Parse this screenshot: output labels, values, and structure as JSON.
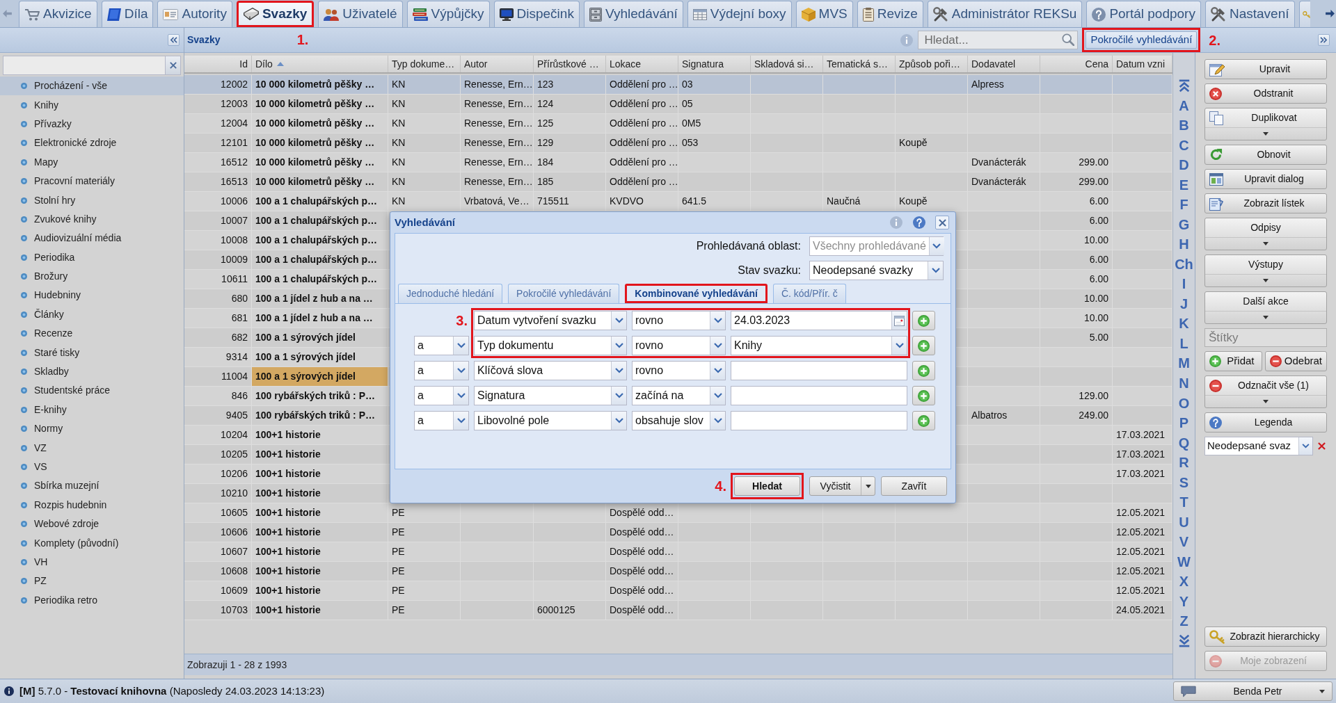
{
  "tabs": [
    {
      "label": "Akvizice",
      "selected": false,
      "outlined": false
    },
    {
      "label": "Díla",
      "selected": false,
      "outlined": false
    },
    {
      "label": "Autority",
      "selected": false,
      "outlined": false
    },
    {
      "label": "Svazky",
      "selected": true,
      "outlined": true,
      "callout": "1."
    },
    {
      "label": "Uživatelé",
      "selected": false,
      "outlined": false
    },
    {
      "label": "Výpůjčky",
      "selected": false,
      "outlined": false
    },
    {
      "label": "Dispečink",
      "selected": false,
      "outlined": false
    },
    {
      "label": "Vyhledávání",
      "selected": false,
      "outlined": false
    },
    {
      "label": "Výdejní boxy",
      "selected": false,
      "outlined": false
    },
    {
      "label": "MVS",
      "selected": false,
      "outlined": false
    },
    {
      "label": "Revize",
      "selected": false,
      "outlined": false
    },
    {
      "label": "Administrátor REKSu",
      "selected": false,
      "outlined": false
    },
    {
      "label": "Portál podpory",
      "selected": false,
      "outlined": false
    },
    {
      "label": "Nastavení",
      "selected": false,
      "outlined": false
    }
  ],
  "sidebar": {
    "items": [
      {
        "label": "Procházení - vše",
        "selected": true
      },
      {
        "label": "Knihy",
        "selected": false
      },
      {
        "label": "Přívazky",
        "selected": false
      },
      {
        "label": "Elektronické zdroje",
        "selected": false
      },
      {
        "label": "Mapy",
        "selected": false
      },
      {
        "label": "Pracovní materiály",
        "selected": false
      },
      {
        "label": "Stolní hry",
        "selected": false
      },
      {
        "label": "Zvukové knihy",
        "selected": false
      },
      {
        "label": "Audiovizuální média",
        "selected": false
      },
      {
        "label": "Periodika",
        "selected": false
      },
      {
        "label": "Brožury",
        "selected": false
      },
      {
        "label": "Hudebniny",
        "selected": false
      },
      {
        "label": "Články",
        "selected": false
      },
      {
        "label": "Recenze",
        "selected": false
      },
      {
        "label": "Staré tisky",
        "selected": false
      },
      {
        "label": "Skladby",
        "selected": false
      },
      {
        "label": "Studentské práce",
        "selected": false
      },
      {
        "label": "E-knihy",
        "selected": false
      },
      {
        "label": "Normy",
        "selected": false
      },
      {
        "label": "VZ",
        "selected": false
      },
      {
        "label": "VS",
        "selected": false
      },
      {
        "label": "Sbírka muzejní",
        "selected": false
      },
      {
        "label": "Rozpis hudebnin",
        "selected": false
      },
      {
        "label": "Webové zdroje",
        "selected": false
      },
      {
        "label": "Komplety (původní)",
        "selected": false
      },
      {
        "label": "VH",
        "selected": false
      },
      {
        "label": "PZ",
        "selected": false
      },
      {
        "label": "Periodika retro",
        "selected": false
      }
    ]
  },
  "panel": {
    "title": "Svazky",
    "search": {
      "placeholder": "Hledat..."
    },
    "advanced_search": {
      "label": "Pokročilé vyhledávání",
      "outlined": true,
      "callout": "2."
    }
  },
  "table": {
    "columns": [
      {
        "label": "Id",
        "sorted": false
      },
      {
        "label": "Dílo",
        "sorted": true
      },
      {
        "label": "Typ dokume…",
        "sorted": false
      },
      {
        "label": "Autor",
        "sorted": false
      },
      {
        "label": "Přírůstkové …",
        "sorted": false
      },
      {
        "label": "Lokace",
        "sorted": false
      },
      {
        "label": "Signatura",
        "sorted": false
      },
      {
        "label": "Skladová si…",
        "sorted": false
      },
      {
        "label": "Tematická s…",
        "sorted": false
      },
      {
        "label": "Způsob poři…",
        "sorted": false
      },
      {
        "label": "Dodavatel",
        "sorted": false
      },
      {
        "label": "Cena",
        "sorted": false
      },
      {
        "label": "Datum vzni",
        "sorted": false
      }
    ],
    "rows": [
      {
        "id": "12002",
        "dilo": "10 000 kilometrů pěšky …",
        "typ_dokume": "KN",
        "autor": "Renesse, Ern…",
        "prirustkove": "123",
        "lokace": "Oddělení pro …",
        "signatura": "03",
        "dodavatel": "Alpress",
        "selected": true,
        "highlighted": false
      },
      {
        "id": "12003",
        "dilo": "10 000 kilometrů pěšky …",
        "typ_dokume": "KN",
        "autor": "Renesse, Ern…",
        "prirustkove": "124",
        "lokace": "Oddělení pro …",
        "signatura": "05",
        "selected": false,
        "highlighted": false
      },
      {
        "id": "12004",
        "dilo": "10 000 kilometrů pěšky …",
        "typ_dokume": "KN",
        "autor": "Renesse, Ern…",
        "prirustkove": "125",
        "lokace": "Oddělení pro …",
        "signatura": "0M5",
        "selected": false,
        "highlighted": false
      },
      {
        "id": "12101",
        "dilo": "10 000 kilometrů pěšky …",
        "typ_dokume": "KN",
        "autor": "Renesse, Ern…",
        "prirustkove": "129",
        "lokace": "Oddělení pro …",
        "signatura": "053",
        "zpusob_pori": "Koupě",
        "selected": false,
        "highlighted": false
      },
      {
        "id": "16512",
        "dilo": "10 000 kilometrů pěšky …",
        "typ_dokume": "KN",
        "autor": "Renesse, Ern…",
        "prirustkove": "184",
        "lokace": "Oddělení pro …",
        "dodavatel": "Dvanácterák",
        "cena": "299.00",
        "selected": false,
        "highlighted": false
      },
      {
        "id": "16513",
        "dilo": "10 000 kilometrů pěšky …",
        "typ_dokume": "KN",
        "autor": "Renesse, Ern…",
        "prirustkove": "185",
        "lokace": "Oddělení pro …",
        "dodavatel": "Dvanácterák",
        "cena": "299.00",
        "selected": false,
        "highlighted": false
      },
      {
        "id": "10006",
        "dilo": "100 a 1 chalupářských p…",
        "typ_dokume": "KN",
        "autor": "Vrbatová, Ve…",
        "prirustkove": "715511",
        "lokace": "KVDVO",
        "signatura": "641.5",
        "tematicka_s": "Naučná",
        "zpusob_pori": "Koupě",
        "cena": "6.00",
        "selected": false,
        "highlighted": false
      },
      {
        "id": "10007",
        "dilo": "100 a 1 chalupářských p…",
        "cena": "6.00",
        "selected": false,
        "highlighted": false
      },
      {
        "id": "10008",
        "dilo": "100 a 1 chalupářských p…",
        "cena": "10.00",
        "selected": false,
        "highlighted": false
      },
      {
        "id": "10009",
        "dilo": "100 a 1 chalupářských p…",
        "cena": "6.00",
        "selected": false,
        "highlighted": false
      },
      {
        "id": "10611",
        "dilo": "100 a 1 chalupářských p…",
        "cena": "6.00",
        "selected": false,
        "highlighted": false
      },
      {
        "id": "680",
        "dilo": "100 a 1 jídel z hub a na …",
        "cena": "10.00",
        "selected": false,
        "highlighted": false
      },
      {
        "id": "681",
        "dilo": "100 a 1 jídel z hub a na …",
        "cena": "10.00",
        "selected": false,
        "highlighted": false
      },
      {
        "id": "682",
        "dilo": "100 a 1 sýrových jídel",
        "cena": "5.00",
        "selected": false,
        "highlighted": false
      },
      {
        "id": "9314",
        "dilo": "100 a 1 sýrových jídel",
        "selected": false,
        "highlighted": false
      },
      {
        "id": "11004",
        "dilo": "100 a 1 sýrových jídel",
        "selected": false,
        "highlighted": true
      },
      {
        "id": "846",
        "dilo": "100 rybářských triků : P…",
        "cena": "129.00",
        "selected": false,
        "highlighted": false
      },
      {
        "id": "9405",
        "dilo": "100 rybářských triků : P…",
        "dodavatel": "Albatros",
        "cena": "249.00",
        "selected": false,
        "highlighted": false
      },
      {
        "id": "10204",
        "dilo": "100+1 historie",
        "datum_vzni": "17.03.2021",
        "selected": false,
        "highlighted": false
      },
      {
        "id": "10205",
        "dilo": "100+1 historie",
        "datum_vzni": "17.03.2021",
        "selected": false,
        "highlighted": false
      },
      {
        "id": "10206",
        "dilo": "100+1 historie",
        "datum_vzni": "17.03.2021",
        "selected": false,
        "highlighted": false
      },
      {
        "id": "10210",
        "dilo": "100+1 historie",
        "selected": false,
        "highlighted": false
      },
      {
        "id": "10605",
        "dilo": "100+1 historie",
        "typ_dokume": "PE",
        "lokace": "Dospělé odd…",
        "datum_vzni": "12.05.2021",
        "selected": false,
        "highlighted": false
      },
      {
        "id": "10606",
        "dilo": "100+1 historie",
        "typ_dokume": "PE",
        "lokace": "Dospělé odd…",
        "datum_vzni": "12.05.2021",
        "selected": false,
        "highlighted": false
      },
      {
        "id": "10607",
        "dilo": "100+1 historie",
        "typ_dokume": "PE",
        "lokace": "Dospělé odd…",
        "datum_vzni": "12.05.2021",
        "selected": false,
        "highlighted": false
      },
      {
        "id": "10608",
        "dilo": "100+1 historie",
        "typ_dokume": "PE",
        "lokace": "Dospělé odd…",
        "datum_vzni": "12.05.2021",
        "selected": false,
        "highlighted": false
      },
      {
        "id": "10609",
        "dilo": "100+1 historie",
        "typ_dokume": "PE",
        "lokace": "Dospělé odd…",
        "datum_vzni": "12.05.2021",
        "selected": false,
        "highlighted": false
      },
      {
        "id": "10703",
        "dilo": "100+1 historie",
        "typ_dokume": "PE",
        "prirustkove": "6000125",
        "lokace": "Dospělé odd…",
        "datum_vzni": "24.05.2021",
        "selected": false,
        "highlighted": false
      }
    ],
    "footer": "Zobrazuji 1 - 28 z 1993"
  },
  "alphabet": [
    "A",
    "B",
    "C",
    "D",
    "E",
    "F",
    "G",
    "H",
    "Ch",
    "I",
    "J",
    "K",
    "L",
    "M",
    "N",
    "O",
    "P",
    "Q",
    "R",
    "S",
    "T",
    "U",
    "V",
    "W",
    "X",
    "Y",
    "Z"
  ],
  "actions": [
    {
      "kind": "button",
      "label": "Upravit",
      "dropdown": false
    },
    {
      "kind": "button",
      "label": "Odstranit",
      "dropdown": false
    },
    {
      "kind": "button",
      "label": "Duplikovat",
      "dropdown": true
    },
    {
      "kind": "button",
      "label": "Obnovit",
      "dropdown": false
    },
    {
      "kind": "button",
      "label": "Upravit dialog",
      "dropdown": false
    },
    {
      "kind": "button",
      "label": "Zobrazit lístek",
      "dropdown": false
    },
    {
      "kind": "button",
      "label": "Odpisy",
      "dropdown": true
    },
    {
      "kind": "button",
      "label": "Výstupy",
      "dropdown": true
    },
    {
      "kind": "button",
      "label": "Další akce",
      "dropdown": true
    },
    {
      "kind": "field",
      "placeholder": "Štítky"
    },
    {
      "kind": "pair",
      "buttons": [
        {
          "label": "Přidat"
        },
        {
          "label": "Odebrat"
        }
      ]
    },
    {
      "kind": "button",
      "label": "Odznačit vše (1)",
      "dropdown": true
    },
    {
      "kind": "button",
      "label": "Legenda",
      "dropdown": false
    },
    {
      "kind": "combo",
      "value": "Neodepsané svaz"
    }
  ],
  "bottom_actions": [
    {
      "label": "Zobrazit hierarchicky",
      "disabled": false
    },
    {
      "label": "Moje zobrazení",
      "disabled": true
    }
  ],
  "dialog": {
    "title": "Vyhledávání",
    "fields": [
      {
        "label": "Prohledávaná oblast:",
        "value": "Všechny prohledávané",
        "disabled": true
      },
      {
        "label": "Stav svazku:",
        "value": "Neodepsané svazky",
        "disabled": false
      }
    ],
    "tabs": [
      {
        "label": "Jednoduché hledání",
        "selected": false,
        "outlined": false
      },
      {
        "label": "Pokročilé vyhledávání",
        "selected": false,
        "outlined": false
      },
      {
        "label": "Kombinované vyhledávání",
        "selected": true,
        "outlined": true
      },
      {
        "label": "Č. kód/Přír. č",
        "selected": false,
        "outlined": false
      }
    ],
    "criteria_callout": "3.",
    "criteria": [
      {
        "field": "Datum vytvoření svazku",
        "relation": "rovno",
        "kind": "date",
        "value": "24.03.2023",
        "outlined": true
      },
      {
        "connector": "a",
        "field": "Typ dokumentu",
        "relation": "rovno",
        "kind": "select",
        "value": "Knihy",
        "outlined": true
      },
      {
        "connector": "a",
        "field": "Klíčová slova",
        "relation": "rovno",
        "kind": "text",
        "outlined": false
      },
      {
        "connector": "a",
        "field": "Signatura",
        "relation": "začíná na",
        "kind": "text",
        "outlined": false
      },
      {
        "connector": "a",
        "field": "Libovolné pole",
        "relation": "obsahuje slov",
        "kind": "text",
        "outlined": false
      }
    ],
    "buttons": [
      {
        "label": "Hledat",
        "kind": "primary",
        "outlined": true,
        "callout": "4."
      },
      {
        "label": "Vyčistit",
        "kind": "split",
        "outlined": false
      },
      {
        "label": "Zavřít",
        "kind": "plain",
        "outlined": false
      }
    ]
  },
  "status_bar": {
    "text": "**[M]** 5.7.0 - **Testovací knihovna** (Naposledy 24.03.2023 14:13:23)",
    "user": "Benda Petr"
  }
}
